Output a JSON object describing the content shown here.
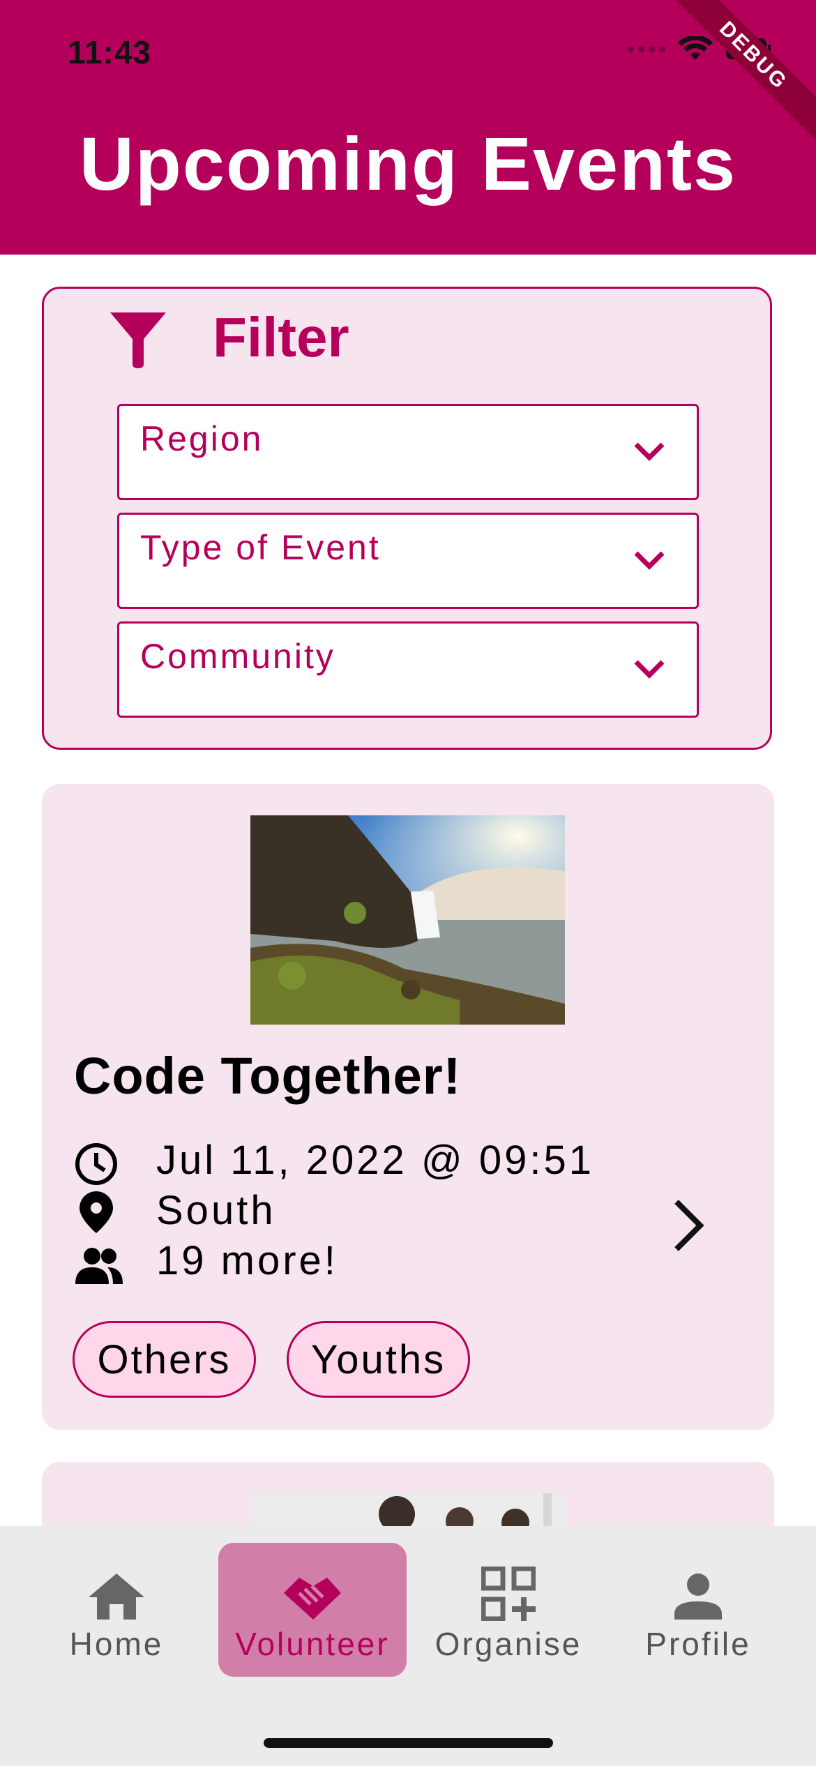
{
  "status_bar": {
    "time": "11:43",
    "debug_banner": "DEBUG"
  },
  "header": {
    "title": "Upcoming Events"
  },
  "filter": {
    "title": "Filter",
    "dropdowns": [
      {
        "label": "Region"
      },
      {
        "label": "Type of Event"
      },
      {
        "label": "Community"
      }
    ]
  },
  "events": [
    {
      "title": "Code Together!",
      "datetime": "Jul 11, 2022 @ 09:51",
      "location": "South",
      "participants": "19 more!",
      "tags": [
        "Others",
        "Youths"
      ]
    }
  ],
  "bottom_nav": {
    "items": [
      {
        "label": "Home",
        "icon": "home-icon"
      },
      {
        "label": "Volunteer",
        "icon": "handshake-icon",
        "active": true
      },
      {
        "label": "Organise",
        "icon": "qr-add-icon"
      },
      {
        "label": "Profile",
        "icon": "person-icon"
      }
    ]
  },
  "colors": {
    "primary": "#B5005B",
    "card_background": "#F6E5EE",
    "tag_background": "#FFD6EA",
    "active_nav_background": "#D17FA8",
    "nav_background": "#EBEBEB"
  }
}
